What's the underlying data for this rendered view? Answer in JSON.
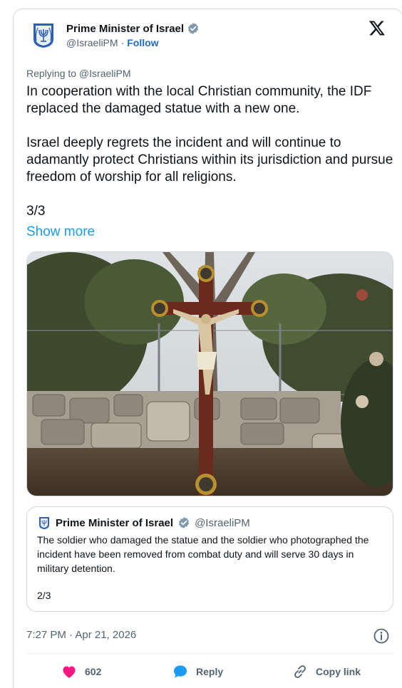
{
  "author": {
    "name": "Prime Minister of Israel",
    "handle": "@IsraeliPM",
    "separator": "·",
    "follow_label": "Follow"
  },
  "post": {
    "replying_to": "Replying to @IsraeliPM",
    "paragraphs": [
      "In cooperation with the local Christian community, the IDF replaced the damaged statue with a new one.",
      "Israel deeply regrets the incident and will continue to adamantly protect Christians within its jurisdiction and pursue freedom of worship for all religions.",
      "3/3"
    ],
    "show_more": "Show more"
  },
  "quote": {
    "name": "Prime Minister of Israel",
    "handle": "@IsraeliPM",
    "text": "The soldier who damaged the statue and the soldier who photographed the incident have been removed from combat duty and will serve 30 days in military detention.",
    "count": "2/3"
  },
  "meta": {
    "timestamp": "7:27 PM · Apr 21, 2026"
  },
  "actions": {
    "likes": "602",
    "reply_label": "Reply",
    "copy_link_label": "Copy link"
  },
  "colors": {
    "accent": "#1d9bf0",
    "like": "#f91880",
    "verified": "#829aab"
  },
  "icons": [
    "israel-emblem-icon",
    "verified-badge-icon",
    "x-logo-icon",
    "info-icon",
    "heart-icon",
    "reply-bubble-icon",
    "link-icon"
  ]
}
